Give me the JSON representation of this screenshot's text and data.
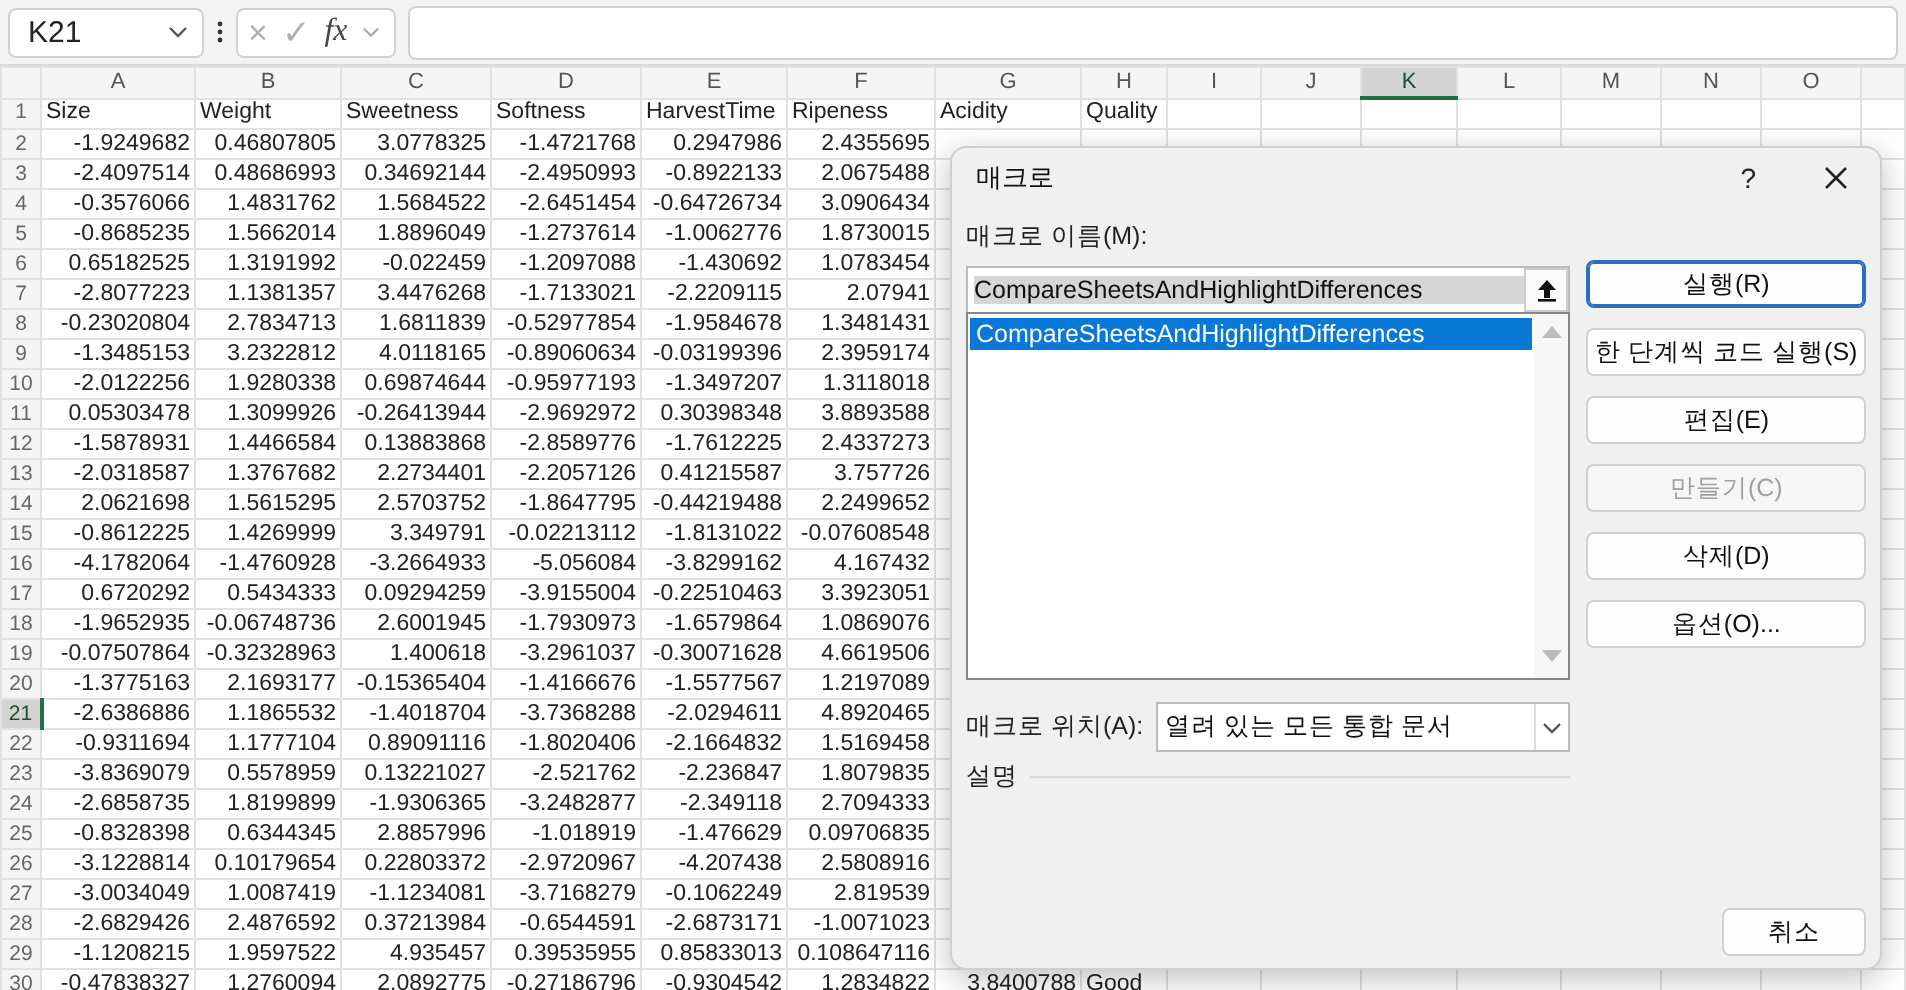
{
  "formula_bar": {
    "name_box": "K21",
    "cancel_icon": "×",
    "enter_icon": "✓",
    "function_label": "fx"
  },
  "sheet": {
    "columns": [
      {
        "label": "A",
        "selected": false
      },
      {
        "label": "B",
        "selected": false
      },
      {
        "label": "C",
        "selected": false
      },
      {
        "label": "D",
        "selected": false
      },
      {
        "label": "E",
        "selected": false
      },
      {
        "label": "F",
        "selected": false
      },
      {
        "label": "G",
        "selected": false
      },
      {
        "label": "H",
        "selected": false
      },
      {
        "label": "I",
        "selected": false
      },
      {
        "label": "J",
        "selected": false
      },
      {
        "label": "K",
        "selected": true
      },
      {
        "label": "L",
        "selected": false
      },
      {
        "label": "M",
        "selected": false
      },
      {
        "label": "N",
        "selected": false
      },
      {
        "label": "O",
        "selected": false
      }
    ],
    "rows": [
      {
        "number": "1",
        "selected": false,
        "kind": "header",
        "cells": [
          "Size",
          "Weight",
          "Sweetness",
          "Softness",
          "HarvestTime",
          "Ripeness",
          "Acidity",
          "Quality"
        ]
      },
      {
        "number": "2",
        "selected": false,
        "kind": "data",
        "cells": [
          "-1.9249682",
          "0.46807805",
          "3.0778325",
          "-1.4721768",
          "0.2947986",
          "2.4355695"
        ]
      },
      {
        "number": "3",
        "selected": false,
        "kind": "data",
        "cells": [
          "-2.4097514",
          "0.48686993",
          "0.34692144",
          "-2.4950993",
          "-0.8922133",
          "2.0675488"
        ]
      },
      {
        "number": "4",
        "selected": false,
        "kind": "data",
        "cells": [
          "-0.3576066",
          "1.4831762",
          "1.5684522",
          "-2.6451454",
          "-0.64726734",
          "3.0906434"
        ]
      },
      {
        "number": "5",
        "selected": false,
        "kind": "data",
        "cells": [
          "-0.8685235",
          "1.5662014",
          "1.8896049",
          "-1.2737614",
          "-1.0062776",
          "1.8730015"
        ]
      },
      {
        "number": "6",
        "selected": false,
        "kind": "data",
        "cells": [
          "0.65182525",
          "1.3191992",
          "-0.022459",
          "-1.2097088",
          "-1.430692",
          "1.0783454"
        ]
      },
      {
        "number": "7",
        "selected": false,
        "kind": "data",
        "cells": [
          "-2.8077223",
          "1.1381357",
          "3.4476268",
          "-1.7133021",
          "-2.2209115",
          "2.07941"
        ]
      },
      {
        "number": "8",
        "selected": false,
        "kind": "data",
        "cells": [
          "-0.23020804",
          "2.7834713",
          "1.6811839",
          "-0.52977854",
          "-1.9584678",
          "1.3481431"
        ]
      },
      {
        "number": "9",
        "selected": false,
        "kind": "data",
        "cells": [
          "-1.3485153",
          "3.2322812",
          "4.0118165",
          "-0.89060634",
          "-0.03199396",
          "2.3959174"
        ]
      },
      {
        "number": "10",
        "selected": false,
        "kind": "data",
        "cells": [
          "-2.0122256",
          "1.9280338",
          "0.69874644",
          "-0.95977193",
          "-1.3497207",
          "1.3118018"
        ]
      },
      {
        "number": "11",
        "selected": false,
        "kind": "data",
        "cells": [
          "0.05303478",
          "1.3099926",
          "-0.26413944",
          "-2.9692972",
          "0.30398348",
          "3.8893588"
        ]
      },
      {
        "number": "12",
        "selected": false,
        "kind": "data",
        "cells": [
          "-1.5878931",
          "1.4466584",
          "0.13883868",
          "-2.8589776",
          "-1.7612225",
          "2.4337273"
        ]
      },
      {
        "number": "13",
        "selected": false,
        "kind": "data",
        "cells": [
          "-2.0318587",
          "1.3767682",
          "2.2734401",
          "-2.2057126",
          "0.41215587",
          "3.757726"
        ]
      },
      {
        "number": "14",
        "selected": false,
        "kind": "data",
        "cells": [
          "2.0621698",
          "1.5615295",
          "2.5703752",
          "-1.8647795",
          "-0.44219488",
          "2.2499652"
        ]
      },
      {
        "number": "15",
        "selected": false,
        "kind": "data",
        "cells": [
          "-0.8612225",
          "1.4269999",
          "3.349791",
          "-0.02213112",
          "-1.8131022",
          "-0.07608548"
        ]
      },
      {
        "number": "16",
        "selected": false,
        "kind": "data",
        "cells": [
          "-4.1782064",
          "-1.4760928",
          "-3.2664933",
          "-5.056084",
          "-3.8299162",
          "4.167432"
        ]
      },
      {
        "number": "17",
        "selected": false,
        "kind": "data",
        "cells": [
          "0.6720292",
          "0.5434333",
          "0.09294259",
          "-3.9155004",
          "-0.22510463",
          "3.3923051"
        ]
      },
      {
        "number": "18",
        "selected": false,
        "kind": "data",
        "cells": [
          "-1.9652935",
          "-0.06748736",
          "2.6001945",
          "-1.7930973",
          "-1.6579864",
          "1.0869076"
        ]
      },
      {
        "number": "19",
        "selected": false,
        "kind": "data",
        "cells": [
          "-0.07507864",
          "-0.32328963",
          "1.400618",
          "-3.2961037",
          "-0.30071628",
          "4.6619506"
        ]
      },
      {
        "number": "20",
        "selected": false,
        "kind": "data",
        "cells": [
          "-1.3775163",
          "2.1693177",
          "-0.15365404",
          "-1.4166676",
          "-1.5577567",
          "1.2197089"
        ]
      },
      {
        "number": "21",
        "selected": true,
        "kind": "data",
        "cells": [
          "-2.6386886",
          "1.1865532",
          "-1.4018704",
          "-3.7368288",
          "-2.0294611",
          "4.8920465"
        ]
      },
      {
        "number": "22",
        "selected": false,
        "kind": "data",
        "cells": [
          "-0.9311694",
          "1.1777104",
          "0.89091116",
          "-1.8020406",
          "-2.1664832",
          "1.5169458"
        ]
      },
      {
        "number": "23",
        "selected": false,
        "kind": "data",
        "cells": [
          "-3.8369079",
          "0.5578959",
          "0.13221027",
          "-2.521762",
          "-2.236847",
          "1.8079835"
        ]
      },
      {
        "number": "24",
        "selected": false,
        "kind": "data",
        "cells": [
          "-2.6858735",
          "1.8199899",
          "-1.9306365",
          "-3.2482877",
          "-2.349118",
          "2.7094333"
        ]
      },
      {
        "number": "25",
        "selected": false,
        "kind": "data",
        "cells": [
          "-0.8328398",
          "0.6344345",
          "2.8857996",
          "-1.018919",
          "-1.476629",
          "0.09706835"
        ]
      },
      {
        "number": "26",
        "selected": false,
        "kind": "data",
        "cells": [
          "-3.1228814",
          "0.10179654",
          "0.22803372",
          "-2.9720967",
          "-4.207438",
          "2.5808916"
        ]
      },
      {
        "number": "27",
        "selected": false,
        "kind": "data",
        "cells": [
          "-3.0034049",
          "1.0087419",
          "-1.1234081",
          "-3.7168279",
          "-0.1062249",
          "2.819539"
        ]
      },
      {
        "number": "28",
        "selected": false,
        "kind": "data",
        "cells": [
          "-2.6829426",
          "2.4876592",
          "0.37213984",
          "-0.6544591",
          "-2.6873171",
          "-1.0071023"
        ]
      },
      {
        "number": "29",
        "selected": false,
        "kind": "data",
        "cells": [
          "-1.1208215",
          "1.9597522",
          "4.935457",
          "0.39535955",
          "0.85833013",
          "0.108647116"
        ]
      },
      {
        "number": "30",
        "selected": false,
        "kind": "data",
        "cells": [
          "-0.47838327",
          "1.2760094",
          "2.0892775",
          "-0.27186796",
          "-0.9304542",
          "1.2834822",
          "3.8400788",
          "Good"
        ]
      }
    ]
  },
  "dialog": {
    "title": "매크로",
    "help": "?",
    "name_label": "매크로 이름(M):",
    "name_value": "CompareSheetsAndHighlightDifferences",
    "macros": [
      {
        "label": "CompareSheetsAndHighlightDifferences",
        "selected": true
      }
    ],
    "buttons": [
      {
        "label": "실행(R)",
        "default": true,
        "disabled": false
      },
      {
        "label": "한 단계씩 코드 실행(S)",
        "default": false,
        "disabled": false
      },
      {
        "label": "편집(E)",
        "default": false,
        "disabled": false
      },
      {
        "label": "만들기(C)",
        "default": false,
        "disabled": true
      },
      {
        "label": "삭제(D)",
        "default": false,
        "disabled": false
      },
      {
        "label": "옵션(O)...",
        "default": false,
        "disabled": false
      }
    ],
    "location_label": "매크로 위치(A):",
    "location_value": "열려 있는 모든 통합 문서",
    "description_label": "설명",
    "cancel": "취소"
  }
}
